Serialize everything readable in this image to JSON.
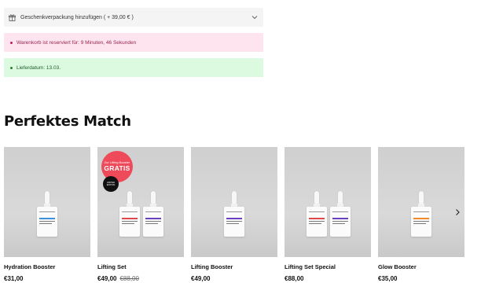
{
  "gift_option": {
    "label": "Geschenkverpackung hinzufügen ( + 39,00 € )"
  },
  "notices": {
    "reserved": "Warenkorb ist reserviert für: 9 Minuten, 46 Sekunden",
    "delivery": "Lieferdatum: 13.03."
  },
  "section": {
    "title": "Perfektes Match"
  },
  "badge": {
    "top": "Zur Lifting Booster",
    "main": "GRATIS",
    "black": "LIMITED EDITION"
  },
  "colors": {
    "pink_bg": "#fde4ee",
    "green_bg": "#dcfadf",
    "badge_red": "#ef4a5a"
  },
  "products": [
    {
      "name": "Hydration Booster",
      "price": "€31,00",
      "old_price": "",
      "bottle_colors": [
        "#3b8fe0"
      ]
    },
    {
      "name": "Lifting Set",
      "price": "€49,00",
      "old_price": "€88,00",
      "bottle_colors": [
        "#e0474a",
        "#6a3fc2"
      ]
    },
    {
      "name": "Lifting Booster",
      "price": "€49,00",
      "old_price": "",
      "bottle_colors": [
        "#6a3fc2"
      ]
    },
    {
      "name": "Lifting Set Special",
      "price": "€88,00",
      "old_price": "",
      "bottle_colors": [
        "#e0474a",
        "#6a3fc2"
      ]
    },
    {
      "name": "Glow Booster",
      "price": "€35,00",
      "old_price": "",
      "bottle_colors": [
        "#f08a24"
      ]
    }
  ]
}
